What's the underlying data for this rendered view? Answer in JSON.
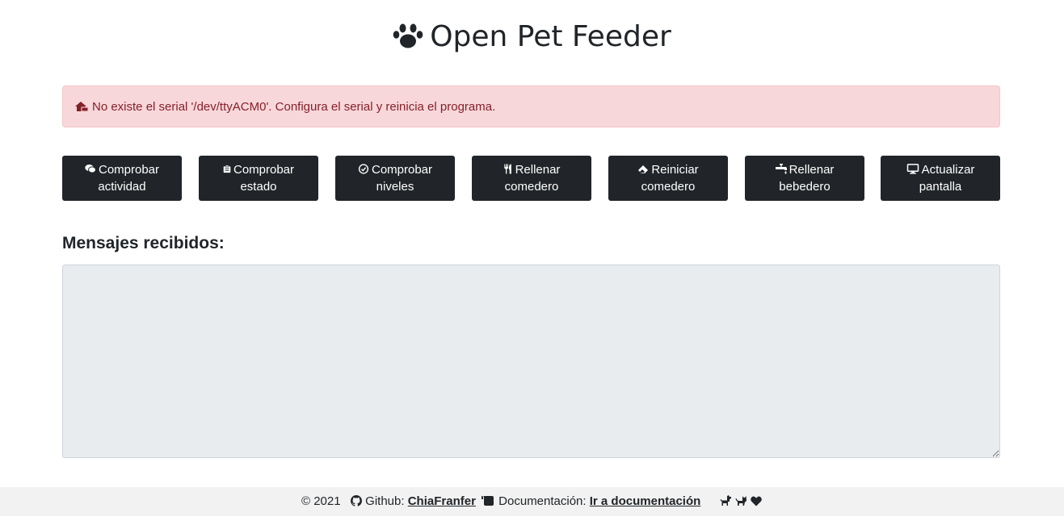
{
  "header": {
    "title": "Open Pet Feeder",
    "icon": "paw-icon"
  },
  "alert": {
    "icon": "house-broken-icon",
    "message": "No existe el serial '/dev/ttyACM0'. Configura el serial y reinicia el programa.",
    "color": "#842029",
    "background": "#f8d7da"
  },
  "actions": [
    {
      "icon": "comments-icon",
      "line1": "Comprobar",
      "line2": "actividad"
    },
    {
      "icon": "clipboard-icon",
      "line1": "Comprobar",
      "line2": "estado"
    },
    {
      "icon": "check-circle-icon",
      "line1": "Comprobar",
      "line2": "niveles"
    },
    {
      "icon": "utensils-icon",
      "line1": "Rellenar",
      "line2": "comedero"
    },
    {
      "icon": "eraser-icon",
      "line1": "Reiniciar",
      "line2": "comedero"
    },
    {
      "icon": "faucet-icon",
      "line1": "Rellenar",
      "line2": "bebedero"
    },
    {
      "icon": "desktop-icon",
      "line1": "Actualizar",
      "line2": "pantalla"
    }
  ],
  "messages": {
    "title": "Mensajes recibidos:",
    "value": ""
  },
  "footer": {
    "copyright": "© 2021",
    "github_label": "Github:",
    "github_link": "ChiaFranfer",
    "docs_label": "Documentación:",
    "docs_link": "Ir a documentación",
    "icons": [
      "dog-icon",
      "cat-icon",
      "heart-icon"
    ]
  },
  "colors": {
    "button_bg": "#212529",
    "textarea_bg": "#e9ecef",
    "footer_bg": "#f2f2f2"
  }
}
